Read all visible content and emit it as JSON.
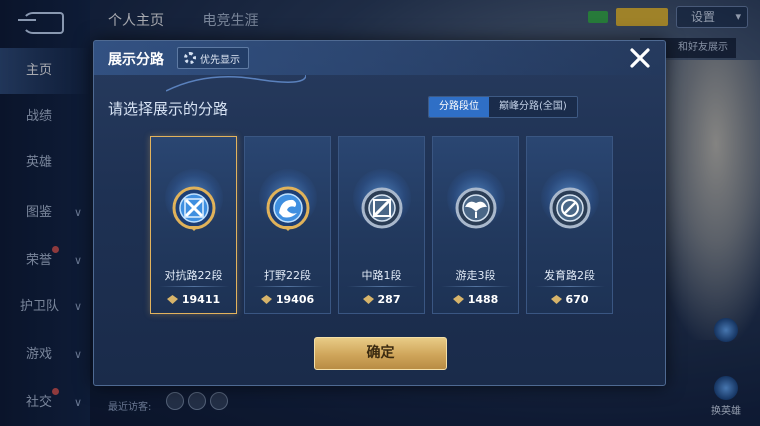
{
  "background": {
    "tabs": [
      "个人主页",
      "电竞生涯"
    ],
    "settings_label": "设置",
    "tip_text": "和好友展示",
    "sidebar": [
      {
        "label": "主页",
        "active": true
      },
      {
        "label": "战绩"
      },
      {
        "label": "英雄"
      },
      {
        "label": "图鉴",
        "chevron": true
      },
      {
        "label": "荣誉",
        "chevron": true,
        "dot": true
      },
      {
        "label": "护卫队",
        "chevron": true
      },
      {
        "label": "游戏",
        "chevron": true
      },
      {
        "label": "社交",
        "chevron": true,
        "dot": true
      }
    ],
    "right_widgets": [
      "换英雄"
    ],
    "recent_label": "最近访客:"
  },
  "modal": {
    "title": "展示分路",
    "priority_label": "优先显示",
    "section_title": "请选择展示的分路",
    "toggle": [
      {
        "label": "分路段位",
        "selected": true
      },
      {
        "label": "巅峰分路(全国)",
        "selected": false
      }
    ],
    "cards": [
      {
        "name": "对抗路22段",
        "score": "19411",
        "badge": "sword-emblem-icon",
        "selected": true
      },
      {
        "name": "打野22段",
        "score": "19406",
        "badge": "dragon-emblem-icon",
        "selected": false
      },
      {
        "name": "中路1段",
        "score": "287",
        "badge": "slash-emblem-icon",
        "selected": false
      },
      {
        "name": "游走3段",
        "score": "1488",
        "badge": "wing-emblem-icon",
        "selected": false
      },
      {
        "name": "发育路2段",
        "score": "670",
        "badge": "target-emblem-icon",
        "selected": false
      }
    ],
    "confirm_label": "确定"
  },
  "colors": {
    "accent_gold": "#e2b35d",
    "toggle_selected": "#2f6fc6",
    "panel": "#1e3153"
  }
}
